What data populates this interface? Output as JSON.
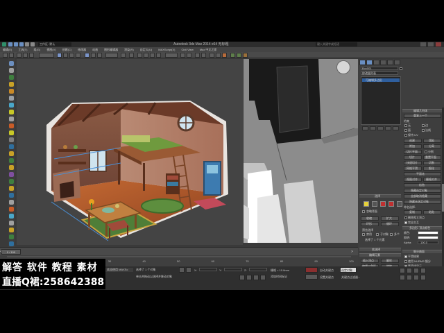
{
  "app": {
    "title": "Autodesk 3ds Max  2014 x64     无标题",
    "search_placeholder": "键入关键字或短语"
  },
  "menu": [
    "编辑(E)",
    "工具(T)",
    "组(G)",
    "视图(V)",
    "创建(C)",
    "修改器",
    "动画",
    "图形编辑器",
    "渲染(R)",
    "自定义(U)",
    "MAXScript(X)",
    "Civil View",
    "Max 中文之家"
  ],
  "toolbar": {
    "workspace": "工作区: 默认"
  },
  "command_panel": {
    "object_name": "Box001",
    "modifier_list": "修改器列表",
    "stack_item": "可编辑多边形",
    "section_selection": "选择",
    "ignore_backfacing": "忽略背面",
    "shrink": "收缩",
    "grow": "扩大",
    "ring": "环形",
    "loop": "循环",
    "preview_selection": "预览选择",
    "disable": "禁用",
    "subobject": "子对象",
    "multi": "多个",
    "selected_count": "选择了 1 个元素",
    "section_soft": "软选择",
    "section_edit_elements": "编辑元素",
    "insert_vertex": "插入顶点",
    "flip": "翻转",
    "edit_tri": "编辑三角形",
    "retri": "重复三角算法",
    "rotate": "旋转",
    "section_edit_geometry": "编辑几何体",
    "repeat_last": "重复上一个",
    "constraints": "约束",
    "none": "无",
    "edge": "边",
    "face": "面",
    "normal": "法线",
    "preserve_uvs": "保持 UV",
    "create": "创建",
    "collapse": "塌陷",
    "attach": "附加",
    "detach": "分离",
    "slice_plane": "切片平面",
    "split": "分割",
    "slice": "切片",
    "reset_plane": "重置平面",
    "quickslice": "快速切片",
    "cut": "切割",
    "meshsmooth": "网格平滑",
    "tessellate": "细化",
    "make_planar": "平面化",
    "view_align": "视图对齐",
    "grid_align": "栅格对齐",
    "relax": "松弛",
    "hide_selected": "隐藏选定对象",
    "unhide_all": "全部取消隐藏",
    "hide_unselected": "隐藏未选定对象",
    "named_selections": "命名选择:",
    "copy": "复制",
    "paste": "粘贴",
    "delete_isolated": "删除孤立顶点",
    "full_interactivity": "完全交互",
    "section_material": "多边形: 材质 ID",
    "set_id": "设置 ID",
    "select_id": "选择 ID",
    "clear_selection": "清除选定内容",
    "section_smoothing": "多边形: 平滑组",
    "select_by_sg": "按平滑组选择",
    "clear_all": "清除全部",
    "auto_smooth": "自动平滑",
    "auto_smooth_value": "45.0",
    "section_vertex_colors": "多边形: 顶点颜色",
    "color": "颜色:",
    "illumination": "照明:",
    "alpha": "Alpha:",
    "alpha_value": "100.0",
    "section_subdivision": "细分曲面",
    "smooth_result": "平滑结果",
    "use_nurms": "使用 NURMS 细分",
    "isoline": "等值线显示",
    "show_cage": "显示框架……",
    "display": "显示",
    "iterations": "迭代次数:",
    "iterations_value": "1",
    "smoothness": "平滑度:",
    "smoothness_value": "1.0",
    "render": "渲染",
    "separate_by": "分隔方式",
    "smoothing_groups": "平滑组",
    "materials": "材质",
    "update_options": "更新选项",
    "always": "始终",
    "when_rendering": "渲染时",
    "manually": "手动",
    "update": "更新",
    "section_subdiv_disp": "细分置换",
    "section_paint": "绘制变形"
  },
  "status": {
    "selected": "选择了 1 个对象",
    "frame_counter": "0 / 100",
    "x_label": "X:",
    "y_label": "Y:",
    "z_label": "Z:",
    "grid": "栅格 = 10.0mm",
    "auto_key": "自动关键点",
    "set_key": "设置关键点",
    "key_filter": "关键点过滤器...",
    "selected_obj": "选定对象",
    "hint": "单击并拖动以选择并移动对象",
    "add_time_tag": "添加时间标记",
    "welcome": "欢迎使用 MAXSc"
  },
  "timeline_ticks": [
    "0",
    "10",
    "20",
    "30",
    "40",
    "50",
    "60",
    "70",
    "80",
    "90",
    "100"
  ],
  "watermark": {
    "line1": "解答 软件 教程 素材",
    "line2": "直播Q裙:258642388"
  },
  "colors": {
    "accent": "#4a8fd6",
    "selection": "#2f5f9e",
    "panel_bg": "#3e3e3e",
    "viewport_bg": "#444444"
  }
}
